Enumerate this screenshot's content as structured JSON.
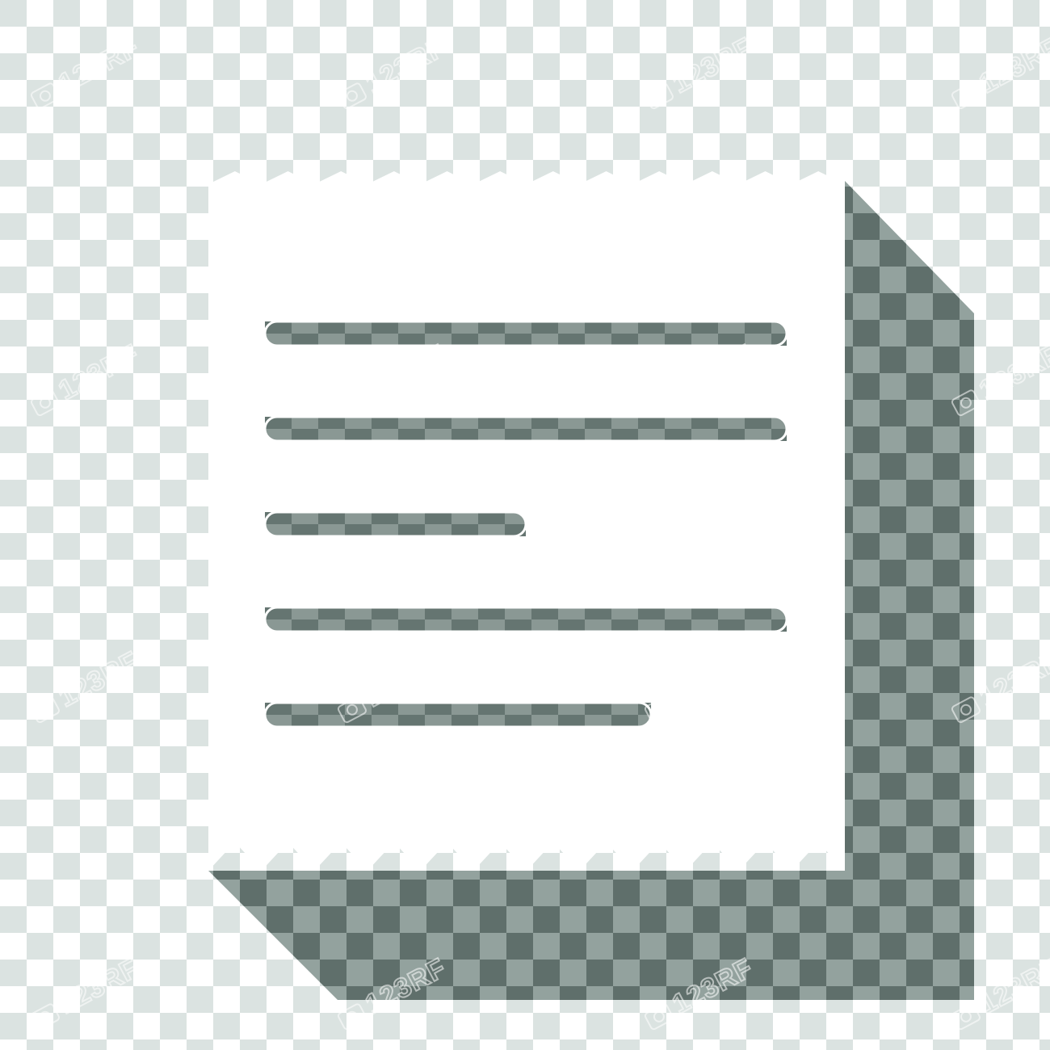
{
  "scene": {
    "subject": "receipt-icon",
    "colors": {
      "checker_light": "#ffffff",
      "checker_dark": "#dbe3e1",
      "checker_dark_shadow": "#5f6f6b",
      "checker_light_shadow": "#93a29e",
      "paper": "#ffffff",
      "slot_dark": "#657571",
      "slot_light": "#8a9894"
    },
    "receipt": {
      "line_lengths": [
        1.0,
        1.0,
        0.5,
        1.0,
        0.74
      ]
    },
    "watermark": {
      "text": "123RF",
      "icon": "camera-icon"
    }
  }
}
